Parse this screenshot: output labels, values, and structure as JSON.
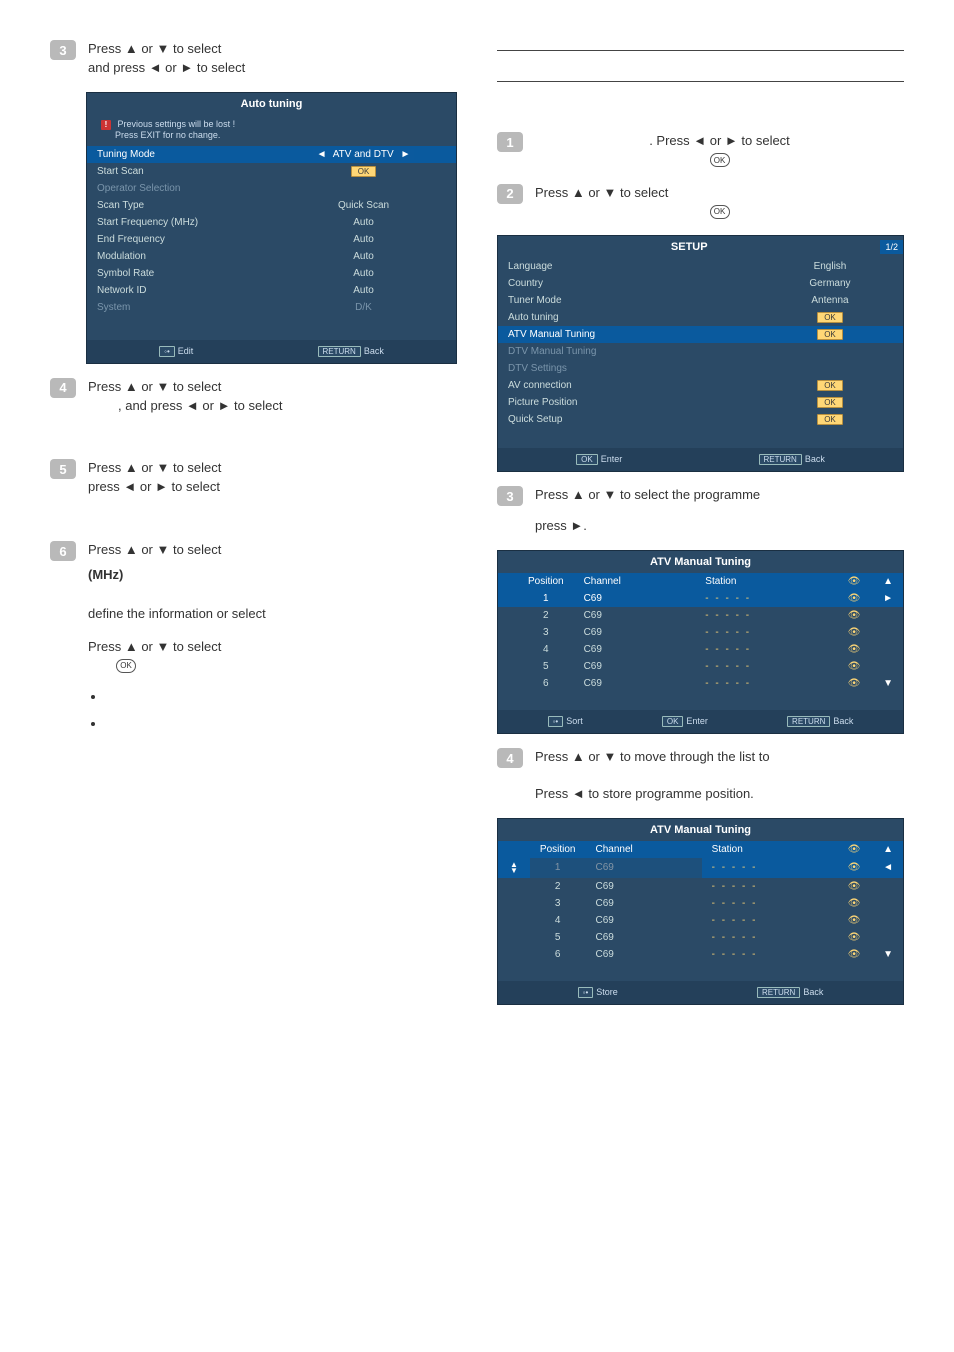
{
  "left": {
    "step3": {
      "line1_pre": "Press ▲ or ▼ to select ",
      "line2_pre": "and press ◄ or ► to select "
    },
    "autoTuning": {
      "title": "Auto tuning",
      "warn1": "Previous settings will be lost !",
      "warn2": "Press EXIT for no change.",
      "rows": [
        {
          "label": "Tuning Mode",
          "value": "ATV and DTV",
          "hl": true,
          "arrows": true
        },
        {
          "label": "Start Scan",
          "value": "OK",
          "okbtn": true
        },
        {
          "label": "Operator Selection",
          "value": "",
          "dim": true
        },
        {
          "label": "Scan Type",
          "value": "Quick Scan"
        },
        {
          "label": "Start Frequency (MHz)",
          "value": "Auto"
        },
        {
          "label": "End Frequency",
          "value": "Auto"
        },
        {
          "label": "Modulation",
          "value": "Auto"
        },
        {
          "label": "Symbol Rate",
          "value": "Auto"
        },
        {
          "label": "Network ID",
          "value": "Auto"
        },
        {
          "label": "System",
          "value": "D/K",
          "dim": true
        }
      ],
      "footer": {
        "edit": "Edit",
        "returnLabel": "RETURN",
        "back": "Back"
      }
    },
    "step4": {
      "line1": "Press ▲ or ▼ to select ",
      "line2": ", and press ◄ or ► to select "
    },
    "step5": {
      "line1": "Press ▲ or ▼ to select ",
      "line2": "press ◄ or ► to select "
    },
    "step6": {
      "line1": "Press ▲ or ▼ to select ",
      "mhz": "(MHz)",
      "line2": "define the information or select ",
      "line3": "Press ▲ or ▼ to select "
    },
    "bullets": [
      "",
      ""
    ]
  },
  "right": {
    "step1": {
      "text": ". Press ◄ or ► to select "
    },
    "step2": {
      "text": "Press ▲ or ▼ to select "
    },
    "setup": {
      "title": "SETUP",
      "page": "1/2",
      "rows": [
        {
          "label": "Language",
          "value": "English"
        },
        {
          "label": "Country",
          "value": "Germany"
        },
        {
          "label": "Tuner Mode",
          "value": "Antenna"
        },
        {
          "label": "Auto tuning",
          "value": "OK",
          "okbtn": true
        },
        {
          "label": "ATV Manual Tuning",
          "value": "OK",
          "okbtn": true,
          "hl": true
        },
        {
          "label": "DTV Manual Tuning",
          "value": "",
          "dim": true
        },
        {
          "label": "DTV Settings",
          "value": "",
          "dim": true
        },
        {
          "label": "AV connection",
          "value": "OK",
          "okbtn": true
        },
        {
          "label": "Picture Position",
          "value": "OK",
          "okbtn": true
        },
        {
          "label": "Quick Setup",
          "value": "OK",
          "okbtn": true
        }
      ],
      "footer": {
        "ok": "OK",
        "enter": "Enter",
        "returnLabel": "RETURN",
        "back": "Back"
      }
    },
    "step3": {
      "line1": "Press ▲ or ▼ to select the programme ",
      "line2": "press ►."
    },
    "atv1": {
      "title": "ATV Manual Tuning",
      "head": {
        "position": "Position",
        "channel": "Channel",
        "station": "Station"
      },
      "rows": [
        {
          "pos": "1",
          "ch": "C69",
          "sel": true
        },
        {
          "pos": "2",
          "ch": "C69"
        },
        {
          "pos": "3",
          "ch": "C69"
        },
        {
          "pos": "4",
          "ch": "C69"
        },
        {
          "pos": "5",
          "ch": "C69"
        },
        {
          "pos": "6",
          "ch": "C69"
        }
      ],
      "footer": {
        "sort": "Sort",
        "ok": "OK",
        "enter": "Enter",
        "returnLabel": "RETURN",
        "back": "Back"
      }
    },
    "step4": {
      "text": "Press ▲ or ▼ to move through the list to "
    },
    "storeText": "Press ◄ to store programme position.",
    "atv2": {
      "title": "ATV Manual Tuning",
      "head": {
        "position": "Position",
        "channel": "Channel",
        "station": "Station"
      },
      "rows": [
        {
          "pos": "1",
          "ch": "C69",
          "sel": true,
          "faded": true
        },
        {
          "pos": "2",
          "ch": "C69"
        },
        {
          "pos": "3",
          "ch": "C69"
        },
        {
          "pos": "4",
          "ch": "C69"
        },
        {
          "pos": "5",
          "ch": "C69"
        },
        {
          "pos": "6",
          "ch": "C69"
        }
      ],
      "footer": {
        "store": "Store",
        "returnLabel": "RETURN",
        "back": "Back"
      }
    }
  }
}
